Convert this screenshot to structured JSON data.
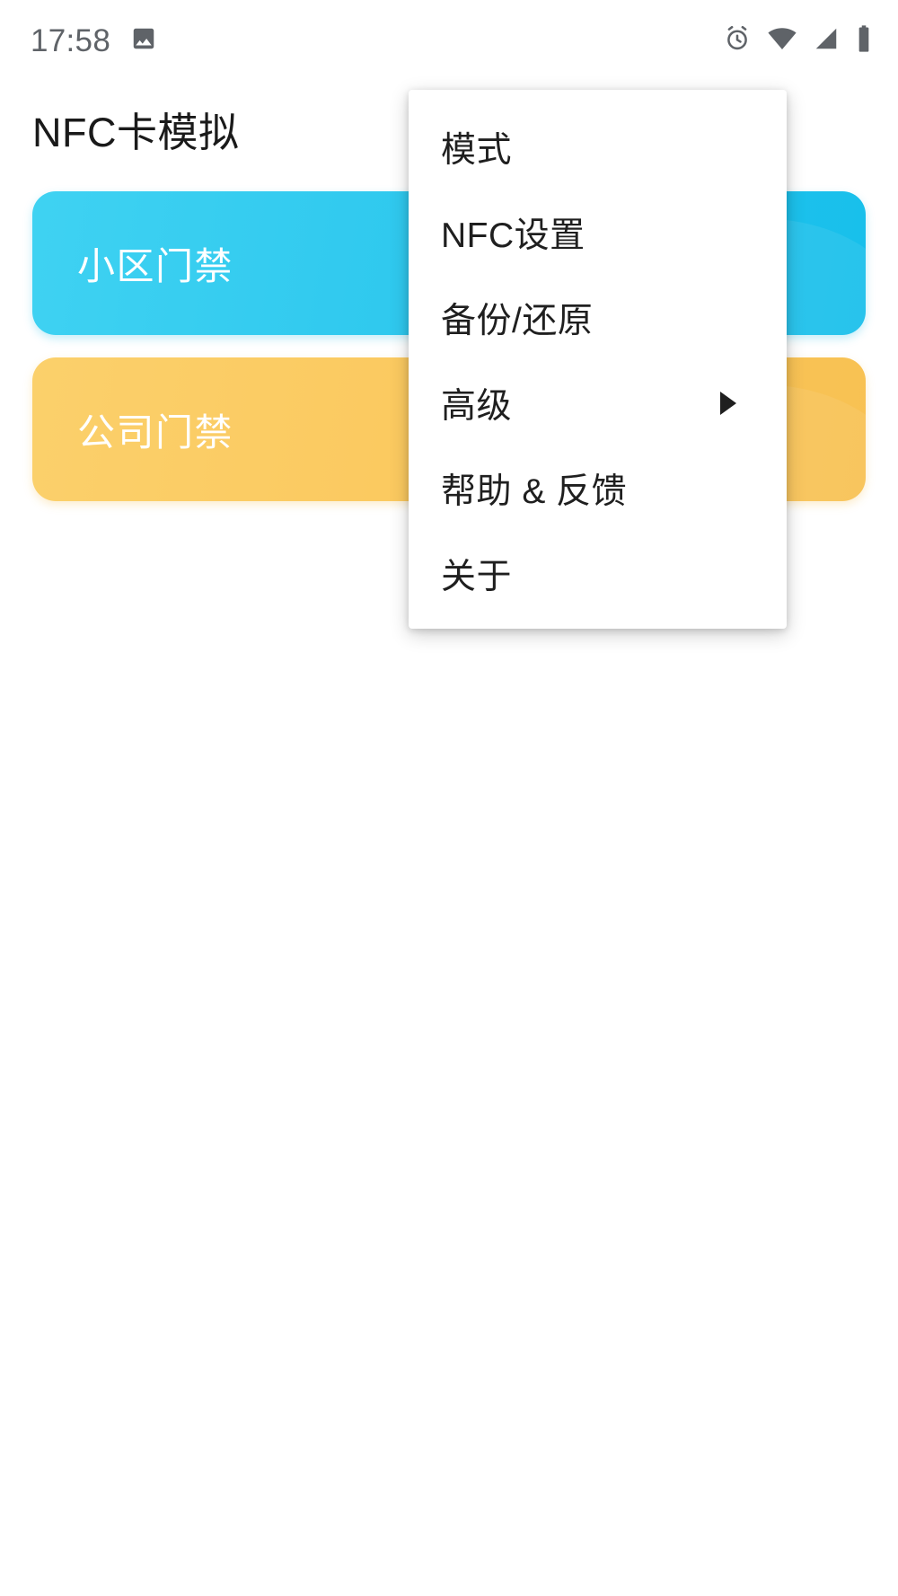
{
  "status_bar": {
    "clock": "17:58",
    "left_icons": [
      {
        "name": "image-gallery-icon",
        "glyph": "image"
      }
    ],
    "right_icons": [
      {
        "name": "alarm-clock-icon",
        "glyph": "alarm"
      },
      {
        "name": "wifi-icon",
        "glyph": "wifi"
      },
      {
        "name": "cellular-signal-icon",
        "glyph": "signal"
      },
      {
        "name": "battery-icon",
        "glyph": "battery"
      }
    ],
    "icon_color": "#5f6368"
  },
  "header": {
    "title": "NFC卡模拟"
  },
  "cards": [
    {
      "label": "小区门禁",
      "color": "#2ec8ee",
      "variant": "blue"
    },
    {
      "label": "公司门禁",
      "color": "#fbc95f",
      "variant": "yellow"
    }
  ],
  "popup_menu": {
    "visible": true,
    "background": "#ffffff",
    "text_color": "#1f1f1f",
    "items": [
      {
        "label": "模式",
        "has_submenu": false
      },
      {
        "label": "NFC设置",
        "has_submenu": false
      },
      {
        "label": "备份/还原",
        "has_submenu": false
      },
      {
        "label": "高级",
        "has_submenu": true
      },
      {
        "label": "帮助 & 反馈",
        "has_submenu": false
      },
      {
        "label": "关于",
        "has_submenu": false
      }
    ]
  }
}
